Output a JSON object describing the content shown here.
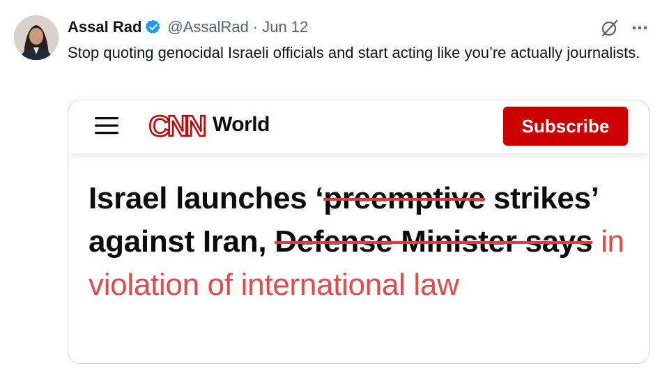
{
  "tweet": {
    "author_name": "Assal Rad",
    "handle": "@AssalRad",
    "separator": "·",
    "date": "Jun 12",
    "text": "Stop quoting genocidal Israeli officials and start acting like you’re actually journalists."
  },
  "icons": {
    "avatar": "profile-photo",
    "verified": "verified-badge-icon",
    "grok": "grok-icon",
    "more": "more-options-icon",
    "menu": "hamburger-menu-icon"
  },
  "colors": {
    "verified_blue": "#1d9bf0",
    "cnn_red": "#cc0000",
    "strike_red": "#e23b3b",
    "added_text_red": "#e44a4a",
    "secondary_text": "#536471"
  },
  "card": {
    "brand_logo": "CNN",
    "section": "World",
    "subscribe_label": "Subscribe",
    "headline": {
      "part1": "Israel launches ‘",
      "struck1": "preemptive",
      "part2": " strikes’ against Iran, ",
      "struck2": "Defense Minister says",
      "added": " in violation of international law"
    }
  }
}
